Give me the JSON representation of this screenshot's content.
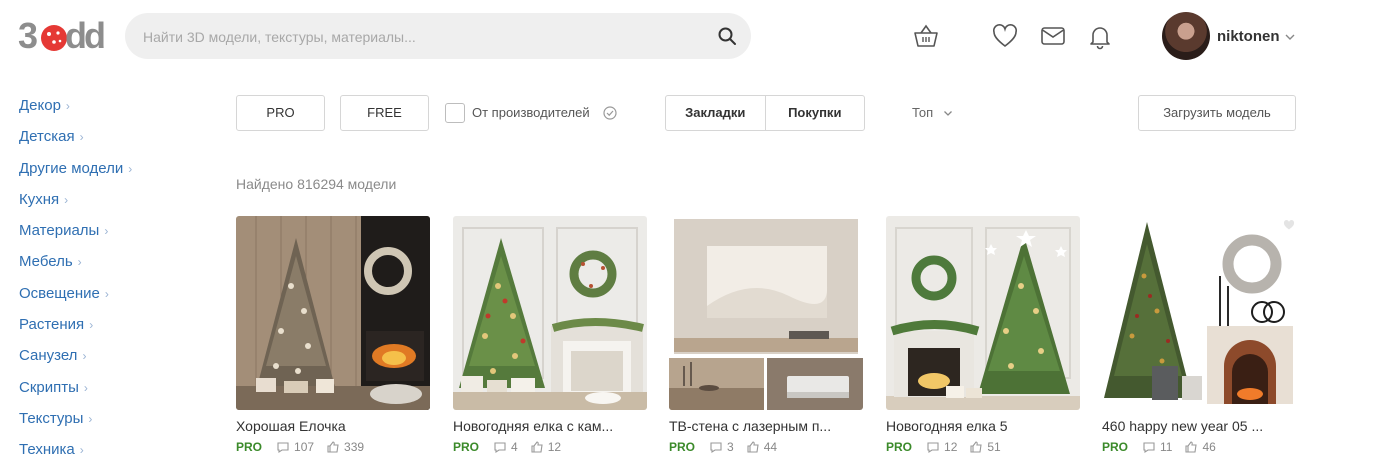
{
  "header": {
    "logo_text": "3dd",
    "search_placeholder": "Найти 3D модели, текстуры, материалы...",
    "search_value": "",
    "icons": [
      "basket-icon",
      "heart-icon",
      "mail-icon",
      "bell-icon",
      "search-icon"
    ],
    "username": "niktonen"
  },
  "sidebar": {
    "items": [
      {
        "label": "Декор"
      },
      {
        "label": "Детская"
      },
      {
        "label": "Другие модели"
      },
      {
        "label": "Кухня"
      },
      {
        "label": "Материалы"
      },
      {
        "label": "Мебель"
      },
      {
        "label": "Освещение"
      },
      {
        "label": "Растения"
      },
      {
        "label": "Санузел"
      },
      {
        "label": "Скрипты"
      },
      {
        "label": "Текстуры"
      },
      {
        "label": "Техника"
      }
    ],
    "chevron": "›"
  },
  "filters": {
    "pro_label": "PRO",
    "free_label": "FREE",
    "manufacturers_label": "От производителей",
    "bookmarks_label": "Закладки",
    "purchases_label": "Покупки",
    "sort_label": "Топ",
    "upload_label": "Загрузить модель"
  },
  "found_text": "Найдено 816294 модели",
  "cards": [
    {
      "title": "Хорошая Елочка",
      "badge": "PRO",
      "comments": "107",
      "likes": "339"
    },
    {
      "title": "Новогодняя елка с кам...",
      "badge": "PRO",
      "comments": "4",
      "likes": "12"
    },
    {
      "title": "ТВ-стена с лазерным п...",
      "badge": "PRO",
      "comments": "3",
      "likes": "44"
    },
    {
      "title": "Новогодняя елка 5",
      "badge": "PRO",
      "comments": "12",
      "likes": "51"
    },
    {
      "title": "460 happy new year 05 ...",
      "badge": "PRO",
      "comments": "11",
      "likes": "46"
    }
  ],
  "colors": {
    "link": "#2f6fb2",
    "pro": "#3b8a2a",
    "logo_red": "#e53935",
    "logo_gray": "#8d8d8d"
  }
}
